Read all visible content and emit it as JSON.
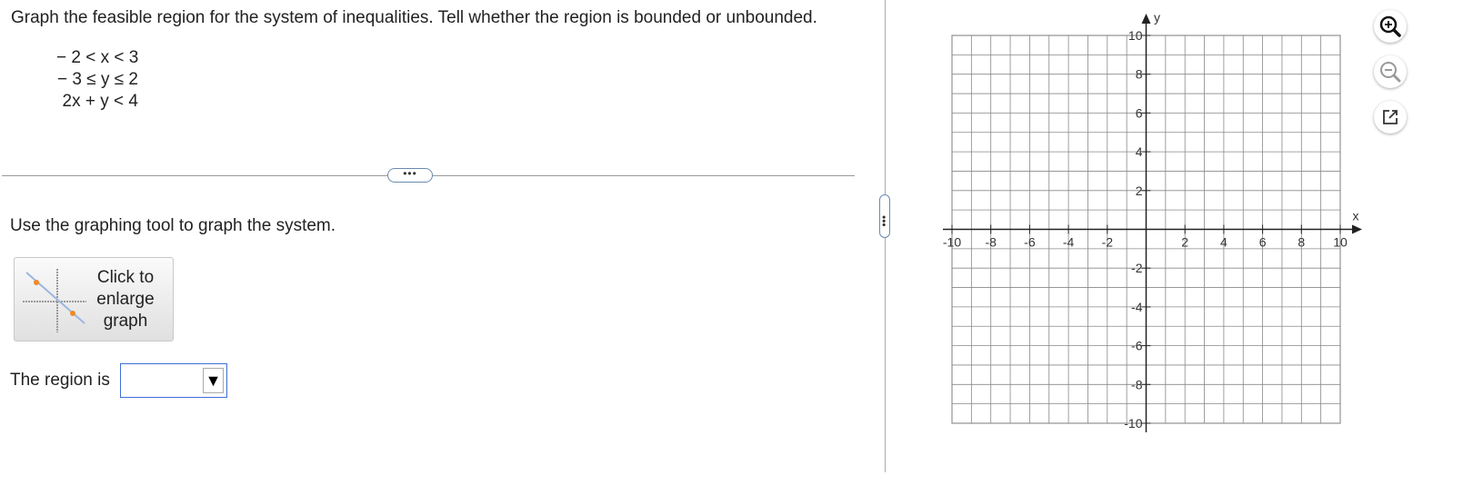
{
  "problem": {
    "prompt": "Graph the feasible region for the system of inequalities. Tell whether the region is bounded or unbounded.",
    "inequalities": [
      "− 2 < x < 3",
      "− 3 ≤ y ≤ 2",
      "2x + y < 4"
    ]
  },
  "divider": {
    "more_label": "•••"
  },
  "instruction": "Use the graphing tool to graph the system.",
  "enlarge_button": {
    "label": "Click to enlarge graph"
  },
  "region": {
    "label": "The region is",
    "selected_value": "",
    "arrow": "▼"
  },
  "splitter": {
    "handle_label": "•••"
  },
  "graph": {
    "x_axis_label": "x",
    "y_axis_label": "y",
    "x_ticks": [
      "-10",
      "-8",
      "-6",
      "-4",
      "-2",
      "2",
      "4",
      "6",
      "8",
      "10"
    ],
    "y_ticks": [
      "10",
      "8",
      "6",
      "4",
      "2",
      "-2",
      "-4",
      "-6",
      "-8",
      "-10"
    ],
    "xlim": [
      -10,
      10
    ],
    "ylim": [
      -10,
      10
    ],
    "grid": true
  },
  "toolbar": {
    "zoom_in_icon": "zoom-in-icon",
    "zoom_out_icon": "zoom-out-icon",
    "popout_icon": "external-link-icon"
  }
}
